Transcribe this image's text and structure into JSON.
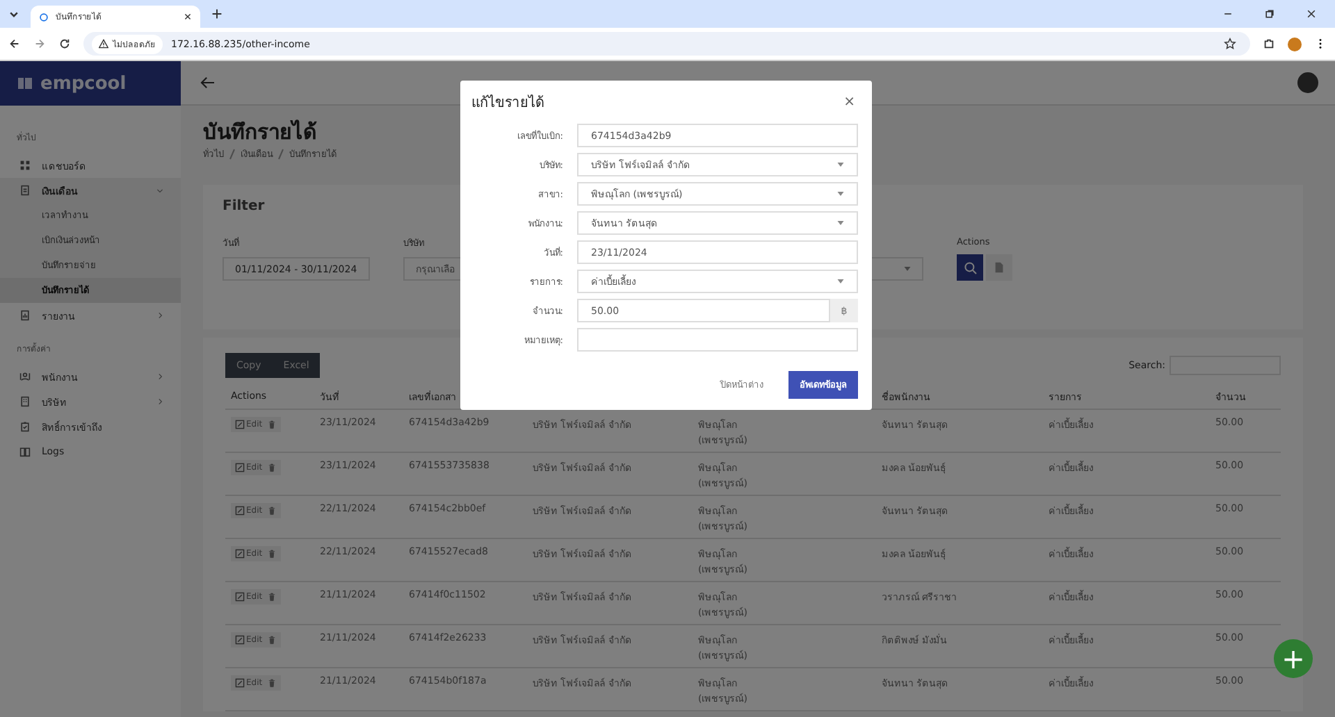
{
  "browser": {
    "tab_title": "บันทึกรายได้",
    "security": "ไม่ปลอดภัย",
    "url": "172.16.88.235/other-income"
  },
  "sidebar": {
    "logo": "empcool",
    "sections": [
      {
        "title": "ทั่วไป",
        "items": [
          {
            "label": "แดชบอร์ด",
            "selected": false
          },
          {
            "label": "เงินเดือน",
            "selected": false,
            "expanded": true,
            "children": [
              {
                "label": "เวลาทำงาน",
                "selected": false
              },
              {
                "label": "เบิกเงินล่วงหน้า",
                "selected": false
              },
              {
                "label": "บันทึกรายจ่าย",
                "selected": false
              },
              {
                "label": "บันทึกรายได้",
                "selected": true
              }
            ]
          },
          {
            "label": "รายงาน",
            "selected": false,
            "expanded": false
          }
        ]
      },
      {
        "title": "การตั้งค่า",
        "items": [
          {
            "label": "พนักงาน",
            "selected": false,
            "expanded": false
          },
          {
            "label": "บริษัท",
            "selected": false,
            "expanded": false
          },
          {
            "label": "สิทธิ์การเข้าถึง",
            "selected": false
          },
          {
            "label": "Logs",
            "selected": false
          }
        ]
      }
    ]
  },
  "page": {
    "title": "บันทึกรายได้",
    "breadcrumb": [
      "ทั่วไป",
      "เงินเดือน",
      "บันทึกรายได้"
    ]
  },
  "filter": {
    "title": "Filter",
    "date_label": "วันที่",
    "date_value": "01/11/2024 - 30/11/2024",
    "company_label": "บริษัท",
    "company_placeholder": "กรุณาเลือ",
    "actions_label": "Actions"
  },
  "table": {
    "buttons": [
      "Copy",
      "Excel"
    ],
    "search_label": "Search:",
    "header": {
      "column_1": "Actions",
      "column_2": "วันที่",
      "column_3": "เลขที่เอกสา",
      "column_6": "ชื่อพนักงาน",
      "column_7": "รายการ",
      "column_8": "จำนวน"
    },
    "rows": [
      [
        "Edit",
        "23/11/2024",
        "674154d3a42b9",
        "บริษัท โฟร์เจมิลล์ จำกัด",
        "พิษณุโลก (เพชรบูรณ์)",
        "จันทนา รัตนสุด",
        "ค่าเบี้ยเลี้ยง",
        "50.00"
      ],
      [
        "Edit",
        "23/11/2024",
        "6741553735838",
        "บริษัท โฟร์เจมิลล์ จำกัด",
        "พิษณุโลก (เพชรบูรณ์)",
        "มงคล น้อยพันธุ์",
        "ค่าเบี้ยเลี้ยง",
        "50.00"
      ],
      [
        "Edit",
        "22/11/2024",
        "674154c2bb0ef",
        "บริษัท โฟร์เจมิลล์ จำกัด",
        "พิษณุโลก (เพชรบูรณ์)",
        "จันทนา รัตนสุด",
        "ค่าเบี้ยเลี้ยง",
        "50.00"
      ],
      [
        "Edit",
        "22/11/2024",
        "67415527ecad8",
        "บริษัท โฟร์เจมิลล์ จำกัด",
        "พิษณุโลก (เพชรบูรณ์)",
        "มงคล น้อยพันธุ์",
        "ค่าเบี้ยเลี้ยง",
        "50.00"
      ],
      [
        "Edit",
        "21/11/2024",
        "67414f0c11502",
        "บริษัท โฟร์เจมิลล์ จำกัด",
        "พิษณุโลก (เพชรบูรณ์)",
        "วราภรณ์ ศรีราชา",
        "ค่าเบี้ยเลี้ยง",
        "50.00"
      ],
      [
        "Edit",
        "21/11/2024",
        "67414f2e26233",
        "บริษัท โฟร์เจมิลล์ จำกัด",
        "พิษณุโลก (เพชรบูรณ์)",
        "กิตติพงษ์ มังมั่น",
        "ค่าเบี้ยเลี้ยง",
        "50.00"
      ],
      [
        "Edit",
        "21/11/2024",
        "674154b0f187a",
        "บริษัท โฟร์เจมิลล์ จำกัด",
        "พิษณุโลก (เพชรบูรณ์)",
        "จันทนา รัตนสุด",
        "ค่าเบี้ยเลี้ยง",
        "50.00"
      ]
    ]
  },
  "dialog": {
    "title": "แก้ไขรายได้",
    "close": "×",
    "fields": [
      {
        "label": "เลขที่ใบเบิก:",
        "kind": "text",
        "value": "674154d3a42b9"
      },
      {
        "label": "บริษัท:",
        "kind": "select",
        "value": "บริษัท โฟร์เจมิลล์ จำกัด"
      },
      {
        "label": "สาขา:",
        "kind": "select",
        "value": "พิษณุโลก (เพชรบูรณ์)"
      },
      {
        "label": "พนักงาน:",
        "kind": "select",
        "value": "จันทนา รัตนสุด"
      },
      {
        "label": "วันที่:",
        "kind": "text",
        "value": "23/11/2024"
      },
      {
        "label": "รายการ:",
        "kind": "select",
        "value": "ค่าเบี้ยเลี้ยง"
      },
      {
        "label": "จำนวน:",
        "kind": "addon",
        "value": "50.00",
        "addon": "฿"
      },
      {
        "label": "หมายเหตุ:",
        "kind": "text"
      }
    ],
    "cancel": "ปิดหน้าต่าง",
    "submit": "อัพเดทข้อมูล"
  },
  "fab": "+"
}
